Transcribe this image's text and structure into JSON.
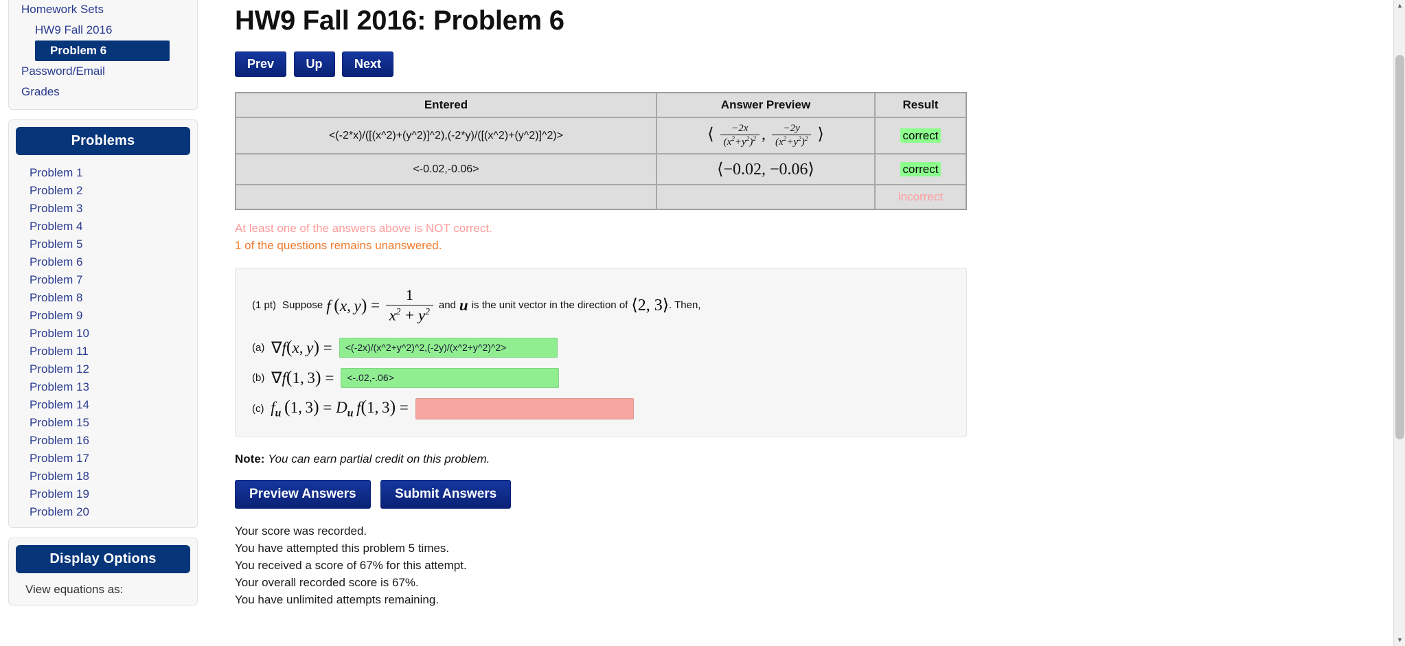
{
  "sidebar": {
    "nav": [
      {
        "label": "Homework Sets",
        "level": 1,
        "active": false
      },
      {
        "label": "HW9 Fall 2016",
        "level": 2,
        "active": false
      },
      {
        "label": "Problem 6",
        "level": 3,
        "active": true
      },
      {
        "label": "Password/Email",
        "level": 1,
        "active": false
      },
      {
        "label": "Grades",
        "level": 1,
        "active": false
      }
    ],
    "problems_panel": {
      "header": "Problems",
      "items": [
        "Problem 1",
        "Problem 2",
        "Problem 3",
        "Problem 4",
        "Problem 5",
        "Problem 6",
        "Problem 7",
        "Problem 8",
        "Problem 9",
        "Problem 10",
        "Problem 11",
        "Problem 12",
        "Problem 13",
        "Problem 14",
        "Problem 15",
        "Problem 16",
        "Problem 17",
        "Problem 18",
        "Problem 19",
        "Problem 20"
      ]
    },
    "display_panel": {
      "header": "Display Options",
      "view_equations_label": "View equations as:"
    }
  },
  "header": {
    "title": "HW9 Fall 2016: Problem 6"
  },
  "nav_buttons": {
    "prev": "Prev",
    "up": "Up",
    "next": "Next"
  },
  "results_table": {
    "columns": [
      "Entered",
      "Answer Preview",
      "Result"
    ],
    "rows": [
      {
        "entered": "<(-2*x)/([(x^2)+(y^2)]^2),(-2*y)/([(x^2)+(y^2)]^2)>",
        "preview_text": "⟨ -2x/(x²+y²)² , -2y/(x²+y²)² ⟩",
        "result": "correct",
        "status": "correct"
      },
      {
        "entered": "<-0.02,-0.06>",
        "preview_text": "⟨−0.02, −0.06⟩",
        "result": "correct",
        "status": "correct"
      },
      {
        "entered": "",
        "preview_text": "",
        "result": "incorrect",
        "status": "incorrect"
      }
    ]
  },
  "messages": {
    "not_correct": "At least one of the answers above is NOT correct.",
    "unanswered": "1 of the questions remains unanswered."
  },
  "problem": {
    "points_label": "(1 pt)",
    "suppose_label": "Suppose",
    "f_of_xy": "f(x, y)",
    "equals": "=",
    "numerator": "1",
    "denominator": "x² + y²",
    "and_text": "and",
    "u_symbol": "u",
    "unit_vector_text": "is the unit vector in the direction of",
    "direction_vector": "⟨2, 3⟩",
    "then_text": ". Then,",
    "parts": [
      {
        "label": "(a)",
        "expr": "∇f(x, y)  =",
        "value": "<(-2x)/(x^2+y^2)^2,(-2y)/(x^2+y^2)^2>",
        "state": "green"
      },
      {
        "label": "(b)",
        "expr": "∇f(1, 3)  =",
        "value": "<-.02,-.06>",
        "state": "green"
      },
      {
        "label": "(c)",
        "expr": "fᵤ (1, 3) = Dᵤ f(1, 3)  =",
        "value": "",
        "state": "red"
      }
    ]
  },
  "note": {
    "prefix": "Note:",
    "text": "You can earn partial credit on this problem."
  },
  "action_buttons": {
    "preview": "Preview Answers",
    "submit": "Submit Answers"
  },
  "score_lines": [
    "Your score was recorded.",
    "You have attempted this problem 5 times.",
    "You received a score of 67% for this attempt.",
    "Your overall recorded score is 67%.",
    "You have unlimited attempts remaining."
  ],
  "colors": {
    "accent_blue": "#06357a",
    "link_blue": "#2a3b8f",
    "correct_green": "#8cff8c",
    "incorrect_pink": "#ff9e9e",
    "field_green": "#90ee90",
    "field_red": "#f6a6a0",
    "warn_orange": "#f0792b"
  }
}
